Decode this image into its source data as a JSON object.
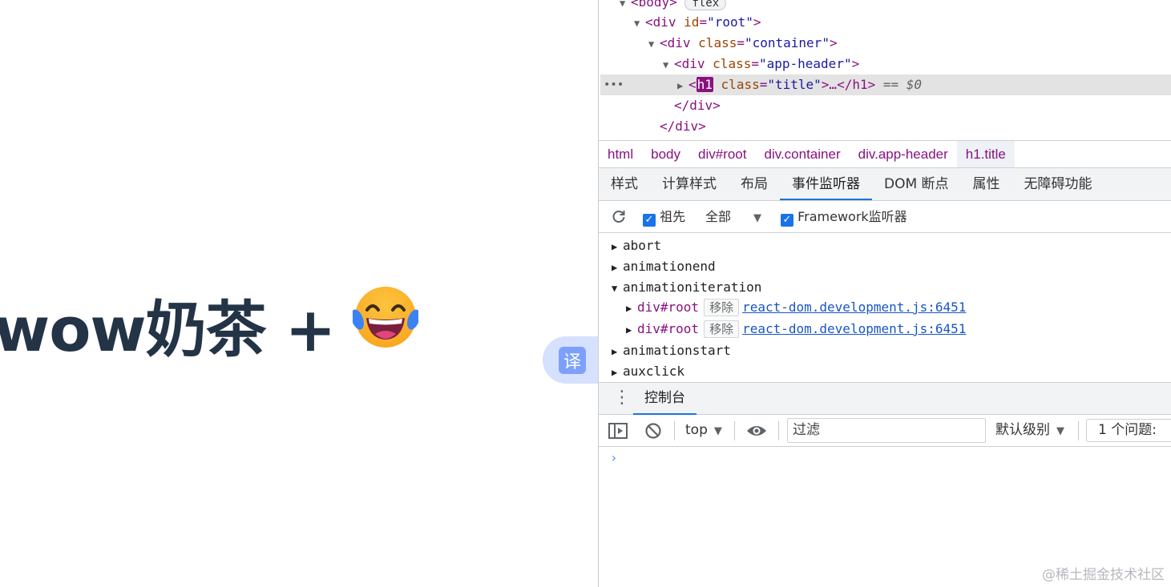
{
  "page": {
    "heading_text": "wow奶茶",
    "heading_plus": "+",
    "emoji": "face-with-tears-of-joy",
    "translate_label": "译"
  },
  "devtools": {
    "dom_tree": {
      "body_line": {
        "tag_open": "<body>",
        "badge": "flex"
      },
      "root_line": {
        "tag": "<div",
        "attr": "id",
        "val": "\"root\"",
        "close": ">"
      },
      "container_line": {
        "tag": "<div",
        "attr": "class",
        "val": "\"container\"",
        "close": ">"
      },
      "header_line": {
        "tag": "<div",
        "attr": "class",
        "val": "\"app-header\"",
        "close": ">"
      },
      "selected_line": {
        "tag_lt": "<",
        "tag_name": "h1",
        "attr": "class",
        "val": "\"title\"",
        "close": ">…</h1>",
        "eq": "== $0"
      },
      "close_header": "</div>",
      "close_container": "</div>",
      "dots": "•••"
    },
    "breadcrumbs": [
      "html",
      "body",
      "div#root",
      "div.container",
      "div.app-header",
      "h1.title"
    ],
    "tabs": [
      "样式",
      "计算样式",
      "布局",
      "事件监听器",
      "DOM 断点",
      "属性",
      "无障碍功能"
    ],
    "active_tab": "事件监听器",
    "event_toolbar": {
      "ancestors_label": "祖先",
      "ancestors_checked": true,
      "scope_value": "全部",
      "framework_label": "Framework监听器",
      "framework_checked": true
    },
    "events": {
      "abort": "abort",
      "animationend": "animationend",
      "animationiteration": "animationiteration",
      "listeners": [
        {
          "target": "div#root",
          "remove": "移除",
          "source": "react-dom.development.js:6451"
        },
        {
          "target": "div#root",
          "remove": "移除",
          "source": "react-dom.development.js:6451"
        }
      ],
      "animationstart": "animationstart",
      "auxclick": "auxclick"
    },
    "drawer": {
      "tab": "控制台"
    },
    "console_toolbar": {
      "context": "top",
      "filter_placeholder": "过滤",
      "level": "默认级别",
      "issues": "1 个问题:"
    },
    "prompt": "›"
  },
  "watermark": "@稀土掘金技术社区",
  "colors": {
    "accent": "#1a73e8",
    "tag": "#881280",
    "attr": "#994500",
    "value": "#1a1aa6",
    "heading": "#243447"
  }
}
